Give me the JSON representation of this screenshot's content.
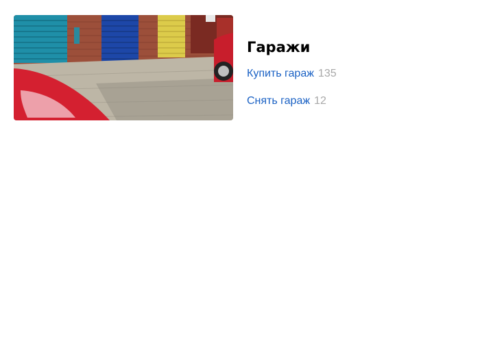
{
  "category": {
    "title": "Гаражи",
    "image_alt": "garage-doors-photo"
  },
  "links": [
    {
      "label": "Купить гараж",
      "count": "135"
    },
    {
      "label": "Снять гараж",
      "count": "12"
    }
  ],
  "colors": {
    "link": "#1a61c4",
    "count": "#a8a8a8",
    "title": "#000000"
  }
}
